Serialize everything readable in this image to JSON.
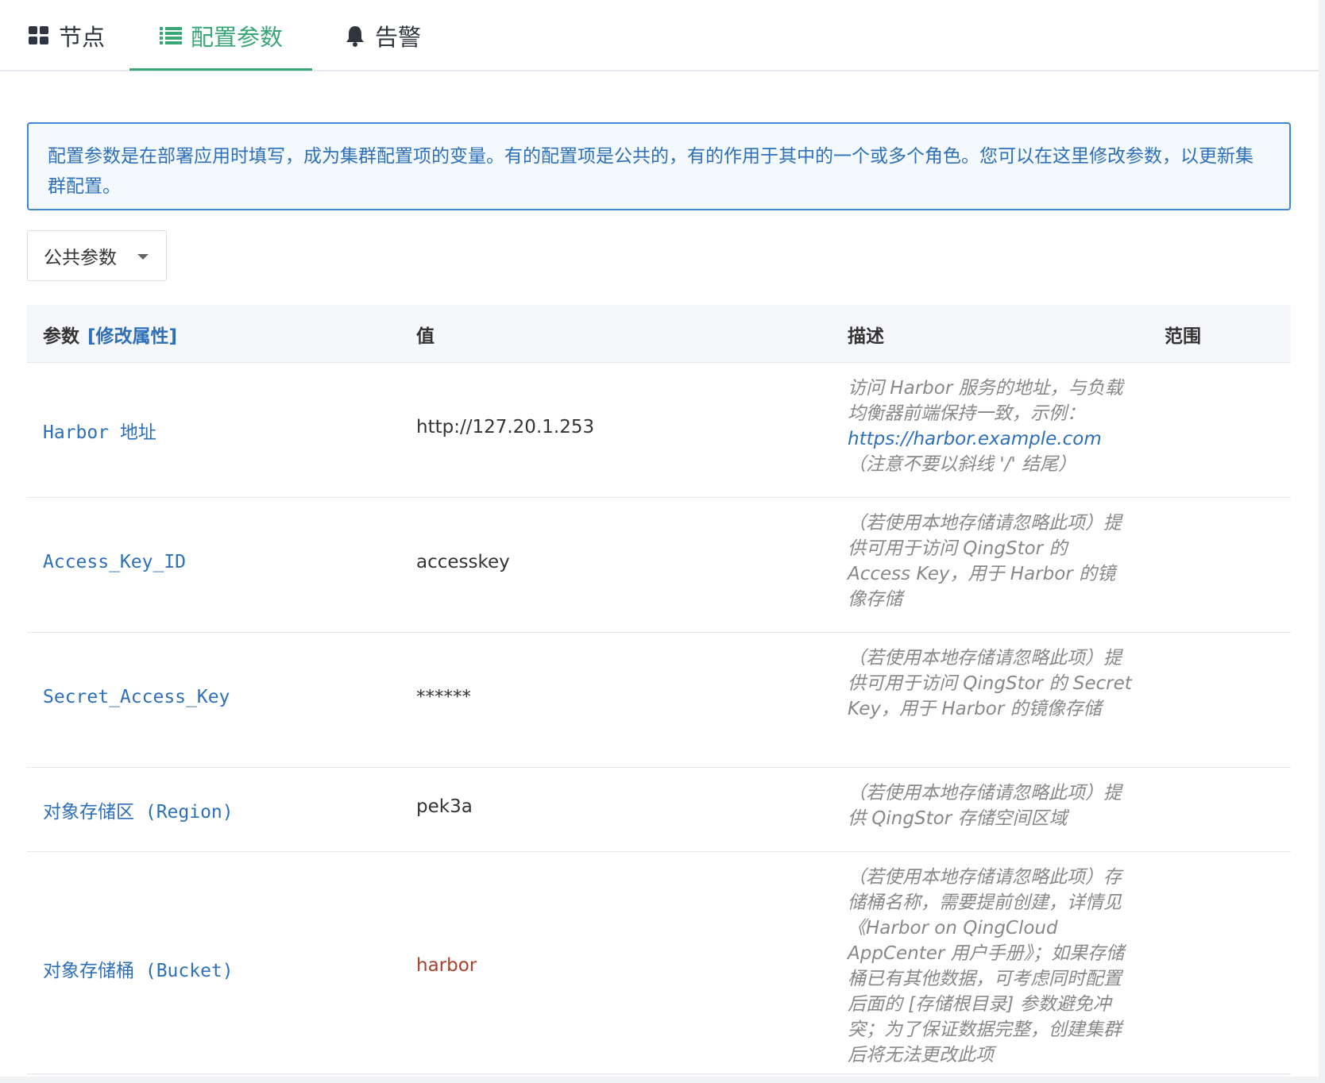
{
  "tabs": [
    {
      "label": "节点",
      "icon": "grid-icon"
    },
    {
      "label": "配置参数",
      "icon": "list-icon"
    },
    {
      "label": "告警",
      "icon": "bell-icon"
    }
  ],
  "info": "配置参数是在部署应用时填写，成为集群配置项的变量。有的配置项是公共的，有的作用于其中的一个或多个角色。您可以在这里修改参数，以更新集群配置。",
  "select": {
    "value": "公共参数"
  },
  "table": {
    "headers": {
      "param": "参数",
      "modify": "[修改属性]",
      "value": "值",
      "desc": "描述",
      "scope": "范围"
    },
    "rows": [
      {
        "name": "Harbor 地址",
        "value": "http://127.20.1.253",
        "desc_pre": "访问 Harbor 服务的地址，与负载均衡器前端保持一致，示例：",
        "desc_link": "https://harbor.example.com",
        "desc_post": " （注意不要以斜线 '/' 结尾）"
      },
      {
        "name": "Access_Key_ID",
        "value": "accesskey",
        "desc": "（若使用本地存储请忽略此项）提供可用于访问 QingStor 的 Access Key，用于 Harbor 的镜像存储"
      },
      {
        "name": "Secret_Access_Key",
        "value": "******",
        "desc": "（若使用本地存储请忽略此项）提供可用于访问 QingStor 的 Secret Key，用于 Harbor 的镜像存储"
      },
      {
        "name": "对象存储区 (Region)",
        "value": "pek3a",
        "desc": "（若使用本地存储请忽略此项）提供 QingStor 存储空间区域"
      },
      {
        "name": "对象存储桶 (Bucket)",
        "value": "harbor",
        "desc": "（若使用本地存储请忽略此项）存储桶名称，需要提前创建，详情见《Harbor on QingCloud AppCenter 用户手册》；如果存储桶已有其他数据，可考虑同时配置后面的 [存储根目录] 参数避免冲突；为了保证数据完整，创建集群后将无法更改此项"
      }
    ]
  },
  "colors": {
    "accent": "#3aa676",
    "link": "#2d6fb8",
    "value_red": "#a5412c"
  }
}
